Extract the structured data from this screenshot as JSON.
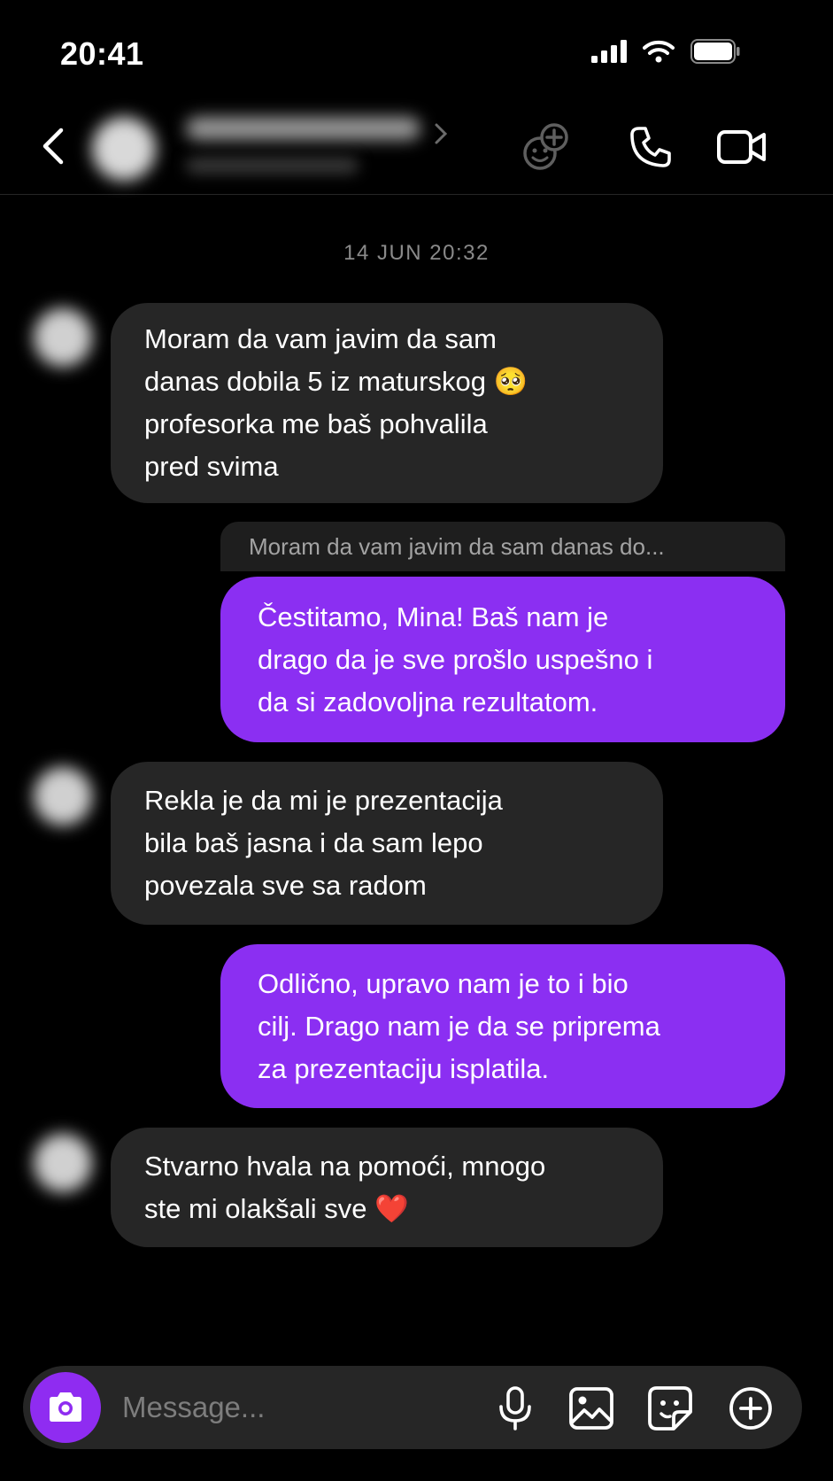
{
  "status_bar": {
    "time": "20:41",
    "icons": [
      "signal-icon",
      "wifi-icon",
      "battery-icon"
    ]
  },
  "header": {
    "icons": [
      "back-icon",
      "chevron-right-icon",
      "add-people-icon",
      "phone-icon",
      "video-icon"
    ]
  },
  "conversation": {
    "timestamp": "14 JUN 20:32",
    "messages": [
      {
        "direction": "incoming",
        "text": "Moram da vam javim da sam\ndanas dobila 5 iz maturskog 🥺\nprofesorka me baš pohvalila\npred svima"
      },
      {
        "direction": "outgoing",
        "reply_preview": "Moram da vam javim da sam danas do...",
        "text": "Čestitamo, Mina! Baš nam je\ndrago da je sve prošlo uspešno i\nda si zadovoljna rezultatom."
      },
      {
        "direction": "incoming",
        "text": "Rekla je da mi je prezentacija\nbila baš jasna i da sam lepo\npovezala sve sa radom"
      },
      {
        "direction": "outgoing",
        "text": "Odlično, upravo nam je to i bio\ncilj. Drago nam je da se priprema\nza prezentaciju isplatila."
      },
      {
        "direction": "incoming",
        "text": "Stvarno hvala na pomoći, mnogo\nste mi olakšali sve ❤️"
      }
    ]
  },
  "composer": {
    "placeholder": "Message...",
    "icons": [
      "camera-icon",
      "microphone-icon",
      "gallery-icon",
      "sticker-icon",
      "plus-icon"
    ]
  },
  "colors": {
    "background": "#000000",
    "incoming_bubble": "#262626",
    "outgoing_bubble": "#8b2ff2",
    "camera_button": "#8f2cf1"
  }
}
